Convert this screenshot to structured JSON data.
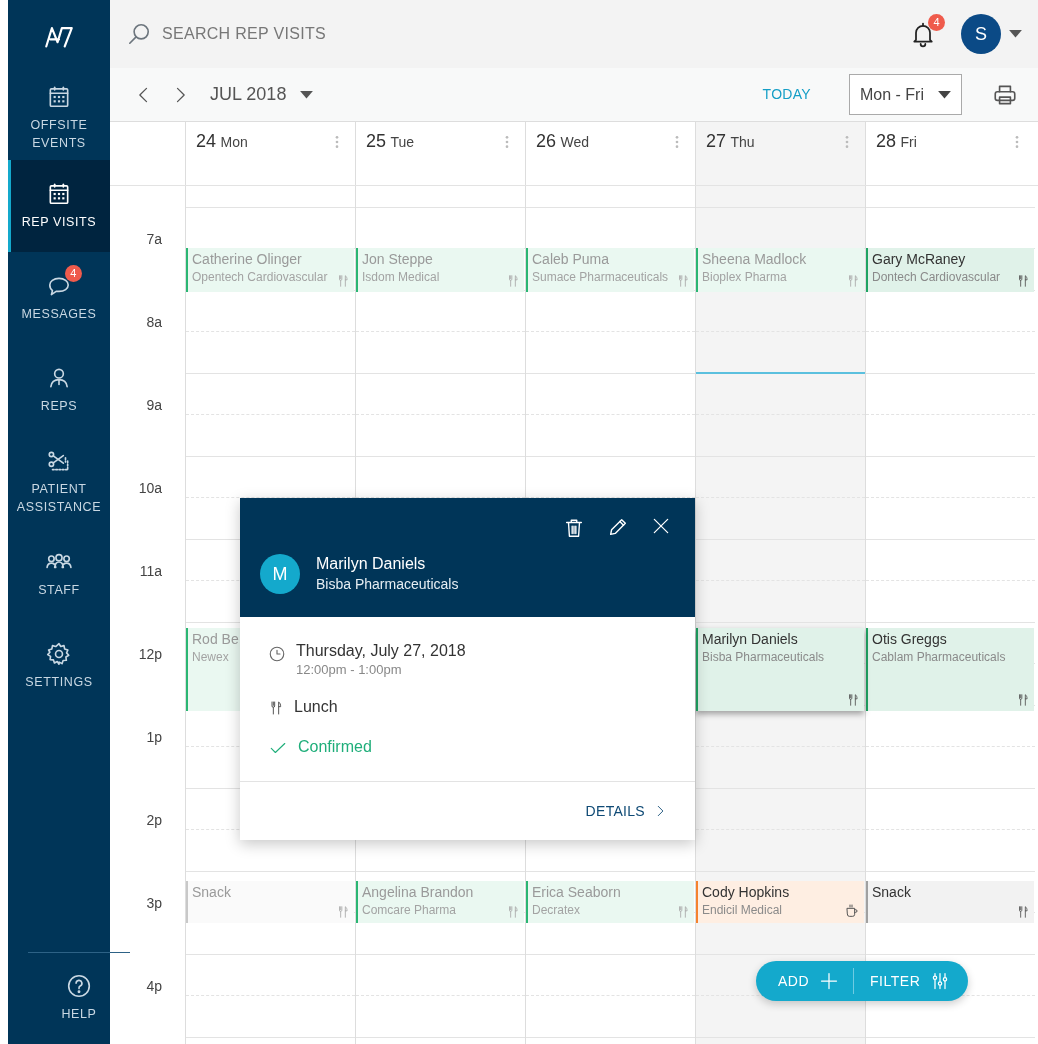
{
  "sidebar": {
    "items": [
      {
        "kind": "calendar",
        "label": "OFFSITE EVENTS",
        "selected": false
      },
      {
        "kind": "calendar",
        "label": "REP VISITS",
        "selected": true
      },
      {
        "kind": "chat",
        "label": "MESSAGES",
        "selected": false,
        "badge": "4"
      },
      {
        "kind": "person",
        "label": "REPS",
        "selected": false
      },
      {
        "kind": "scissors",
        "label": "PATIENT ASSISTANCE",
        "selected": false
      },
      {
        "kind": "people",
        "label": "STAFF",
        "selected": false
      },
      {
        "kind": "gear",
        "label": "SETTINGS",
        "selected": false
      }
    ],
    "help": {
      "label": "HELP"
    }
  },
  "topbar": {
    "search": {
      "placeholder": "SEARCH REP VISITS"
    },
    "notifications": {
      "badge": "4"
    },
    "avatar": {
      "initial": "S"
    }
  },
  "toolbar": {
    "month": "JUL 2018",
    "today": "TODAY",
    "range": "Mon - Fri"
  },
  "calendar": {
    "days": [
      {
        "date": "24",
        "weekday": "Mon",
        "today": false
      },
      {
        "date": "25",
        "weekday": "Tue",
        "today": false
      },
      {
        "date": "26",
        "weekday": "Wed",
        "today": false
      },
      {
        "date": "27",
        "weekday": "Thu",
        "today": true
      },
      {
        "date": "28",
        "weekday": "Fri",
        "today": false
      }
    ],
    "hours": [
      "7a",
      "8a",
      "9a",
      "10a",
      "11a",
      "12p",
      "1p",
      "2p",
      "3p",
      "4p"
    ],
    "event_rows": [
      [
        {
          "name": "Catherine Olinger",
          "company": "Opentech Cardiovascular",
          "kind": "lunch",
          "color": "#2bb673",
          "past": true,
          "selected": false
        },
        {
          "name": "Jon Steppe",
          "company": "Isdom Medical",
          "kind": "lunch",
          "color": "#2bb673",
          "past": true,
          "selected": false
        },
        {
          "name": "Caleb Puma",
          "company": "Sumace Pharmaceuticals",
          "kind": "lunch",
          "color": "#2bb673",
          "past": true,
          "selected": false
        },
        {
          "name": "Sheena Madlock",
          "company": "Bioplex Pharma",
          "kind": "lunch",
          "color": "#2bb673",
          "past": true,
          "selected": false
        },
        {
          "name": "Gary McRaney",
          "company": "Dontech Cardiovascular",
          "kind": "lunch",
          "color": "#1fa463",
          "past": false,
          "selected": false
        }
      ],
      [
        {
          "name": "Rod Be",
          "company": "Newex",
          "kind": "none",
          "color": "#2bb673",
          "past": true,
          "selected": false
        },
        null,
        null,
        {
          "name": "Marilyn Daniels",
          "company": "Bisba Pharmaceuticals",
          "kind": "lunch",
          "color": "#1fa463",
          "past": false,
          "selected": true
        },
        {
          "name": "Otis Greggs",
          "company": "Cablam Pharmaceuticals",
          "kind": "lunch",
          "color": "#1fa463",
          "past": false,
          "selected": false
        }
      ],
      [
        {
          "name": "Snack",
          "kind": "lunch",
          "color": "#c8c8c8",
          "past": true,
          "selected": false
        },
        {
          "name": "Angelina Brandon",
          "company": "Comcare Pharma",
          "kind": "lunch",
          "color": "#2bb673",
          "past": true,
          "selected": false
        },
        {
          "name": "Erica Seaborn",
          "company": "Decratex",
          "kind": "lunch",
          "color": "#2bb673",
          "past": true,
          "selected": false
        },
        {
          "name": "Cody Hopkins",
          "company": "Endicil Medical",
          "kind": "coffee",
          "color": "#f5822f",
          "past": false,
          "selected": false
        },
        {
          "name": "Snack",
          "kind": "lunch",
          "color": "#a0a0a0",
          "past": false,
          "selected": false
        }
      ]
    ]
  },
  "popover": {
    "avatar": "M",
    "name": "Marilyn Daniels",
    "company": "Bisba Pharmaceuticals",
    "date": "Thursday, July 27, 2018",
    "time": "12:00pm - 1:00pm",
    "meal": "Lunch",
    "status": "Confirmed",
    "confirmed": true,
    "details": "DETAILS"
  },
  "fab": {
    "add": "ADD",
    "filter": "FILTER"
  }
}
